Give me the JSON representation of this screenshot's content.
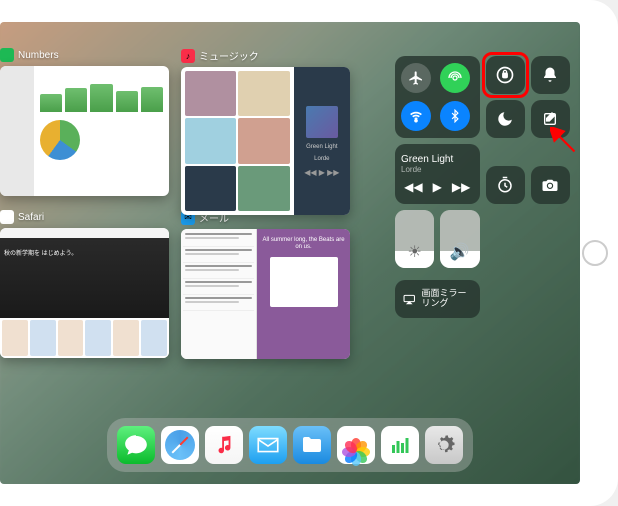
{
  "apps": {
    "numbers": {
      "label": "Numbers"
    },
    "music": {
      "label": "ミュージック",
      "now_title": "Green Light",
      "now_artist": "Lorde"
    },
    "safari": {
      "label": "Safari",
      "hero": "秋の新学期を\\nはじめよう。"
    },
    "mail": {
      "label": "メール",
      "banner": "All summer long,\\nthe Beats are on us."
    }
  },
  "control_center": {
    "media": {
      "title": "Green Light",
      "artist": "Lorde"
    },
    "mirror": {
      "label": "画面ミラーリング"
    }
  },
  "dock": {
    "items": [
      "messages",
      "safari",
      "music",
      "mail",
      "files",
      "photos",
      "stocks",
      "settings"
    ]
  }
}
